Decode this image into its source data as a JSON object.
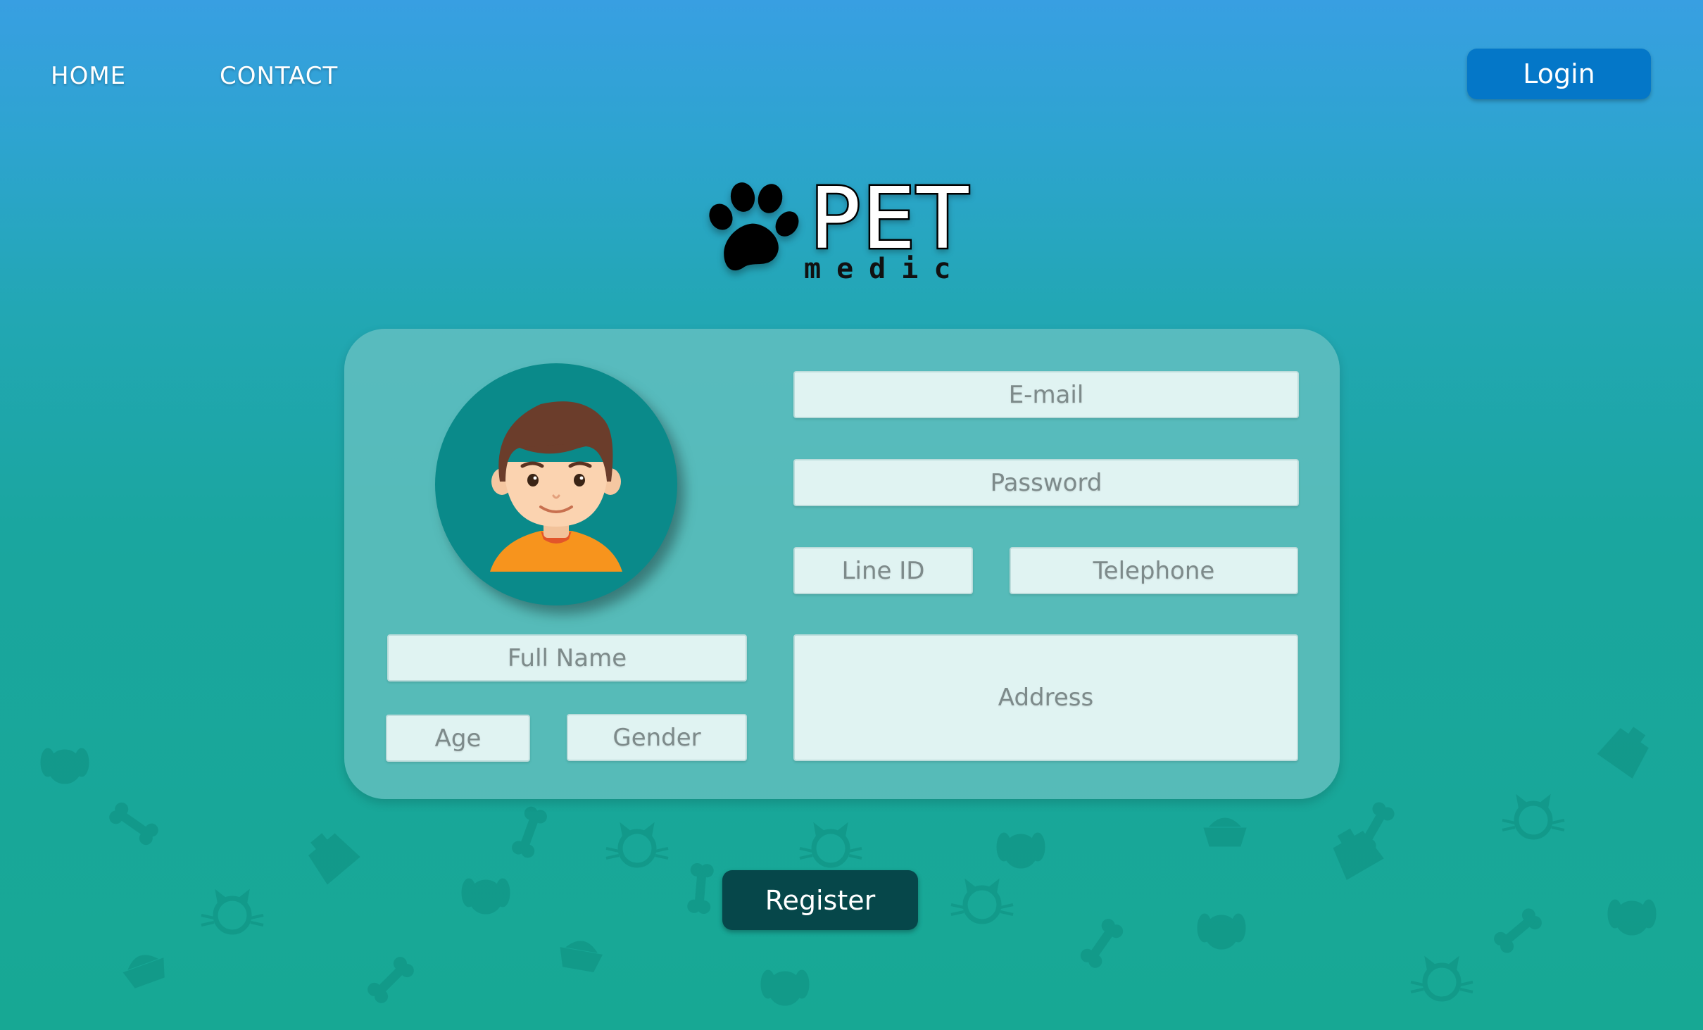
{
  "nav": {
    "home_label": "HOME",
    "contact_label": "CONTACT"
  },
  "header": {
    "login_label": "Login"
  },
  "logo": {
    "title": "PET",
    "subtitle": "medic",
    "icon": "paw-icon"
  },
  "form": {
    "email_placeholder": "E-mail",
    "password_placeholder": "Password",
    "line_id_placeholder": "Line ID",
    "telephone_placeholder": "Telephone",
    "full_name_placeholder": "Full Name",
    "address_placeholder": "Address",
    "age_placeholder": "Age",
    "gender_placeholder": "Gender",
    "register_label": "Register"
  },
  "colors": {
    "login_button": "#0477c8",
    "register_button": "#06474a",
    "avatar_background": "#0a8a8a",
    "background_top": "#389fe2",
    "background_bottom": "#17a894"
  }
}
